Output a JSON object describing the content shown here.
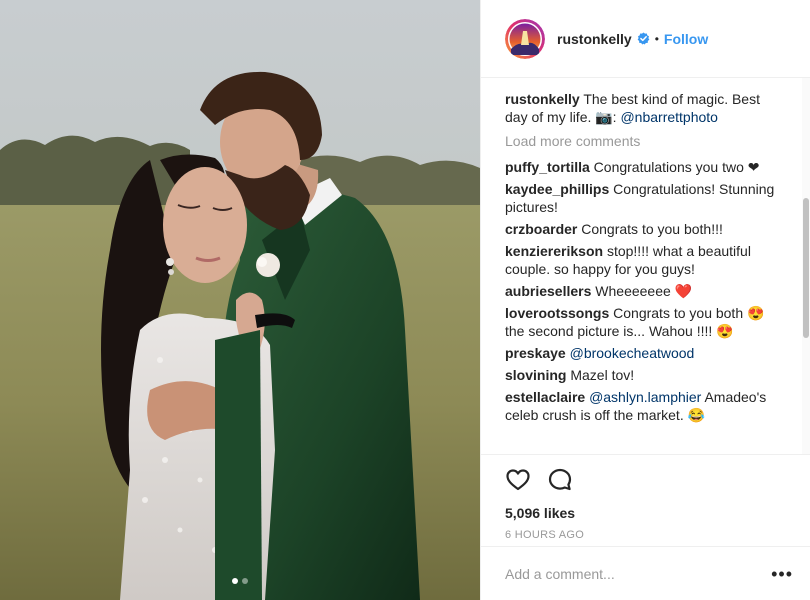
{
  "post": {
    "username": "rustonkelly",
    "follow_label": "Follow",
    "bullet": "•",
    "caption_text": "The best kind of magic. Best day of my life. 📷: ",
    "caption_mention": "@nbarrettphoto",
    "load_more": "Load more comments",
    "likes": "5,096 likes",
    "time": "6 HOURS AGO",
    "add_comment_placeholder": "Add a comment...",
    "more_label": "•••",
    "carousel": {
      "total": 2,
      "active": 1
    }
  },
  "comments": [
    {
      "user": "puffy_tortilla",
      "text": "Congratulations you two ❤"
    },
    {
      "user": "kaydee_phillips",
      "text": "Congratulations! Stunning pictures!"
    },
    {
      "user": "crzboarder",
      "text": "Congrats to you both!!!"
    },
    {
      "user": "kenziererikson",
      "text": "stop!!!! what a beautiful couple. so happy for you guys!"
    },
    {
      "user": "aubriesellers",
      "text": "Wheeeeeee ❤️"
    },
    {
      "user": "loverootssongs",
      "text": "Congrats to you both 😍 the second picture is... Wahou !!!! 😍"
    },
    {
      "user": "preskaye",
      "mention": "@brookecheatwood"
    },
    {
      "user": "slovining",
      "text": "Mazel tov!"
    },
    {
      "user": "estellaclaire",
      "mention": "@ashlyn.lamphier",
      "text": "Amadeo's celeb crush is off the market. 😂"
    }
  ],
  "colors": {
    "accent": "#3897f0",
    "heart": "#ed4956",
    "velvet": "#1f4a2c",
    "text": "#262626",
    "muted": "#999999"
  },
  "icons": {
    "verified": "verified-badge-icon",
    "like": "heart-icon",
    "comment": "comment-bubble-icon",
    "more": "more-options-icon"
  }
}
